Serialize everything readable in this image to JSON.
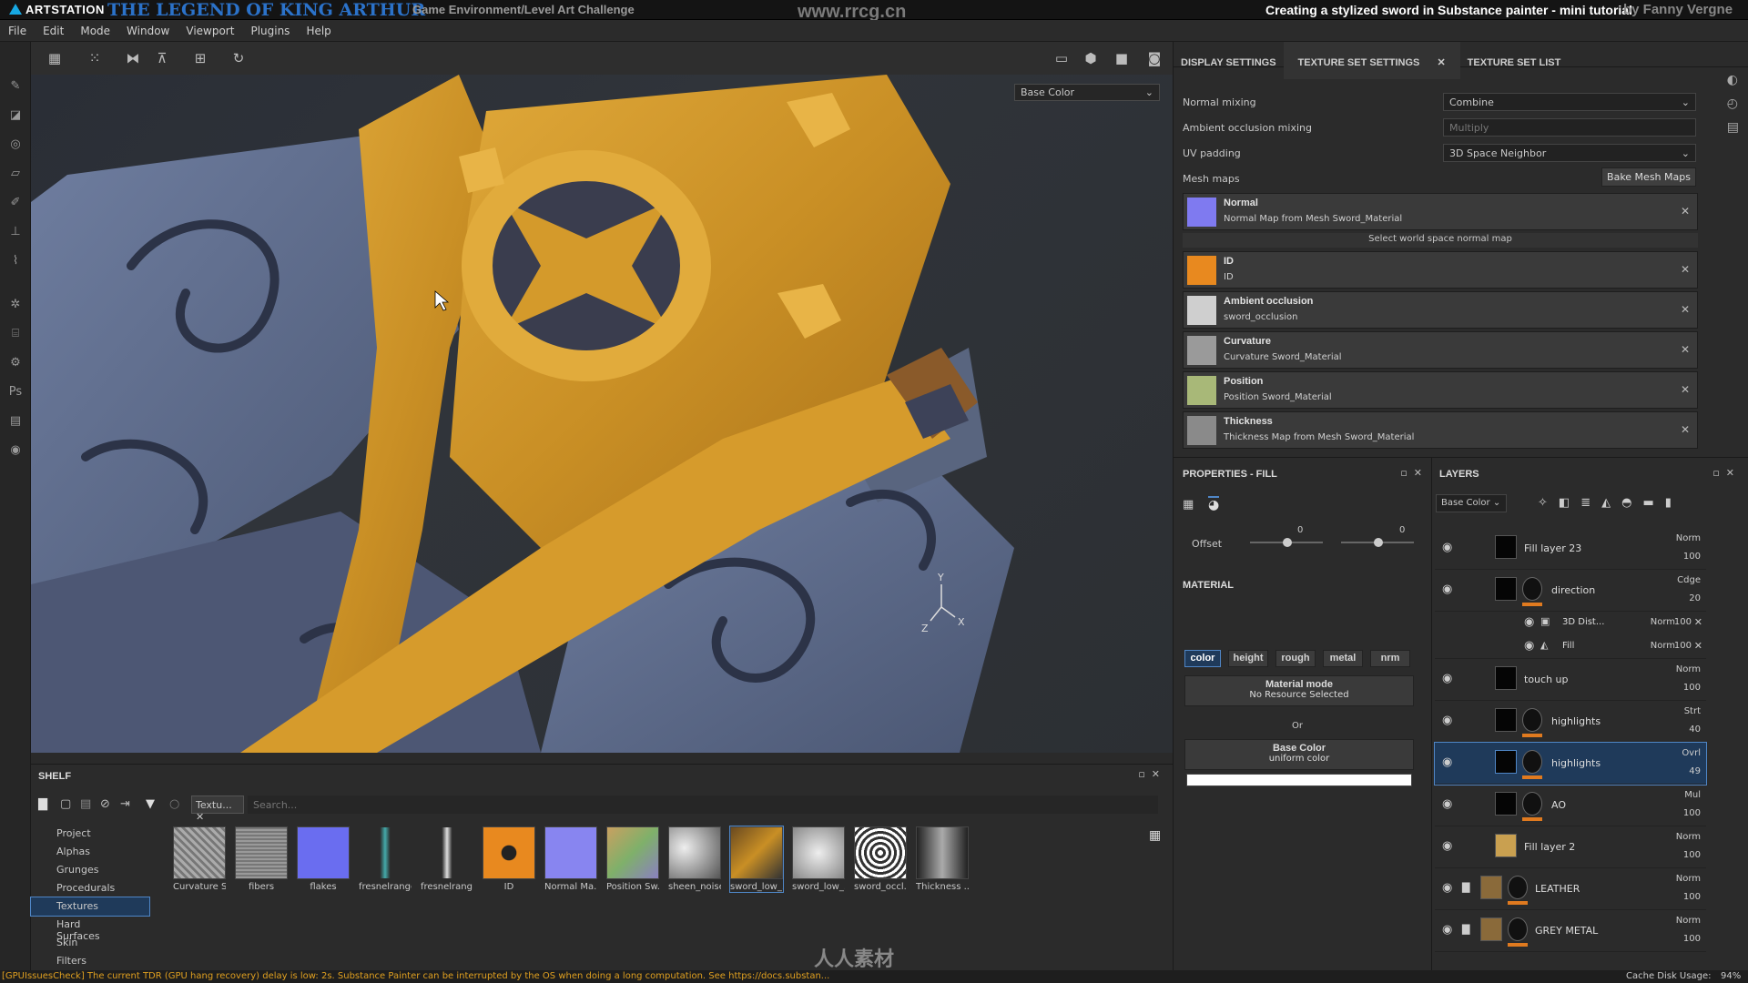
{
  "banner": {
    "artstation": "ARTSTATION",
    "legend": "THE LEGEND OF KING ARTHUR",
    "challenge": "Game Environment/Level Art Challenge",
    "watermark": "www.rrcg.cn",
    "tutorial": "Creating a stylized sword in Substance painter - mini tutorial",
    "author": "by Fanny Vergne"
  },
  "menu": [
    "File",
    "Edit",
    "Mode",
    "Window",
    "Viewport",
    "Plugins",
    "Help"
  ],
  "viewport": {
    "channel": "Base Color",
    "axis_y": "Y",
    "axis_z": "Z",
    "axis_x": "X"
  },
  "right_tabs": [
    "DISPLAY SETTINGS",
    "TEXTURE SET SETTINGS",
    "TEXTURE SET LIST"
  ],
  "texset": {
    "normal_mixing_label": "Normal mixing",
    "normal_mixing": "Combine",
    "ao_mixing_label": "Ambient occlusion mixing",
    "ao_mixing": "Multiply",
    "uv_padding_label": "UV padding",
    "uv_padding": "3D Space Neighbor",
    "mesh_maps_label": "Mesh maps",
    "bake_button": "Bake Mesh Maps",
    "select_world": "Select world space normal map",
    "maps": [
      {
        "title": "Normal",
        "sub": "Normal Map from Mesh Sword_Material",
        "color": "#7f7af0"
      },
      {
        "title": "ID",
        "sub": "ID",
        "color": "#e8891f"
      },
      {
        "title": "Ambient occlusion",
        "sub": "sword_occlusion",
        "color": "#cfcfcf"
      },
      {
        "title": "Curvature",
        "sub": "Curvature Sword_Material",
        "color": "#9a9a9a"
      },
      {
        "title": "Position",
        "sub": "Position Sword_Material",
        "color": "#a8b878"
      },
      {
        "title": "Thickness",
        "sub": "Thickness Map from Mesh Sword_Material",
        "color": "#8a8a8a"
      }
    ]
  },
  "properties": {
    "title": "PROPERTIES - FILL",
    "offset_label": "Offset",
    "offset_a": "0",
    "offset_b": "0",
    "material_label": "MATERIAL",
    "chips": [
      "color",
      "height",
      "rough",
      "metal",
      "nrm"
    ],
    "mode_title": "Material mode",
    "mode_sub": "No Resource Selected",
    "or": "Or",
    "base_title": "Base Color",
    "base_sub": "uniform color"
  },
  "layers": {
    "title": "LAYERS",
    "channel": "Base Color",
    "items": [
      {
        "name": "Fill layer 23",
        "blend": "Norm",
        "opacity": "100"
      },
      {
        "name": "direction",
        "blend": "Cdge",
        "opacity": "20"
      },
      {
        "name": "3D Dist...",
        "blend": "Norm",
        "opacity": "100"
      },
      {
        "name": "Fill",
        "blend": "Norm",
        "opacity": "100"
      },
      {
        "name": "touch up",
        "blend": "Norm",
        "opacity": "100"
      },
      {
        "name": "highlights",
        "blend": "Strt",
        "opacity": "40"
      },
      {
        "name": "highlights",
        "blend": "Ovrl",
        "opacity": "49"
      },
      {
        "name": "AO",
        "blend": "Mul",
        "opacity": "100"
      },
      {
        "name": "Fill layer 2",
        "blend": "Norm",
        "opacity": "100"
      },
      {
        "name": "LEATHER",
        "blend": "Norm",
        "opacity": "100"
      },
      {
        "name": "GREY METAL",
        "blend": "Norm",
        "opacity": "100"
      }
    ]
  },
  "shelf": {
    "title": "SHELF",
    "filter_tab": "Textu...",
    "search_placeholder": "Search...",
    "categories": [
      "Project",
      "Alphas",
      "Grunges",
      "Procedurals",
      "Textures",
      "Hard Surfaces",
      "Skin",
      "Filters"
    ],
    "thumbs": [
      "Curvature S...",
      "fibers",
      "flakes",
      "fresnelranges",
      "fresnelrang...",
      "ID",
      "Normal Ma...",
      "Position Sw...",
      "sheen_noise",
      "sword_low_...",
      "sword_low_...",
      "sword_occl...",
      "Thickness ..."
    ]
  },
  "status": {
    "message": "[GPUIssuesCheck] The current TDR (GPU hang recovery) delay is low: 2s. Substance Painter can be interrupted by the OS when doing a long computation. See https://docs.substan...",
    "cache": "Cache Disk Usage:",
    "cache_value": "94%"
  },
  "watermark2": "人人素材"
}
